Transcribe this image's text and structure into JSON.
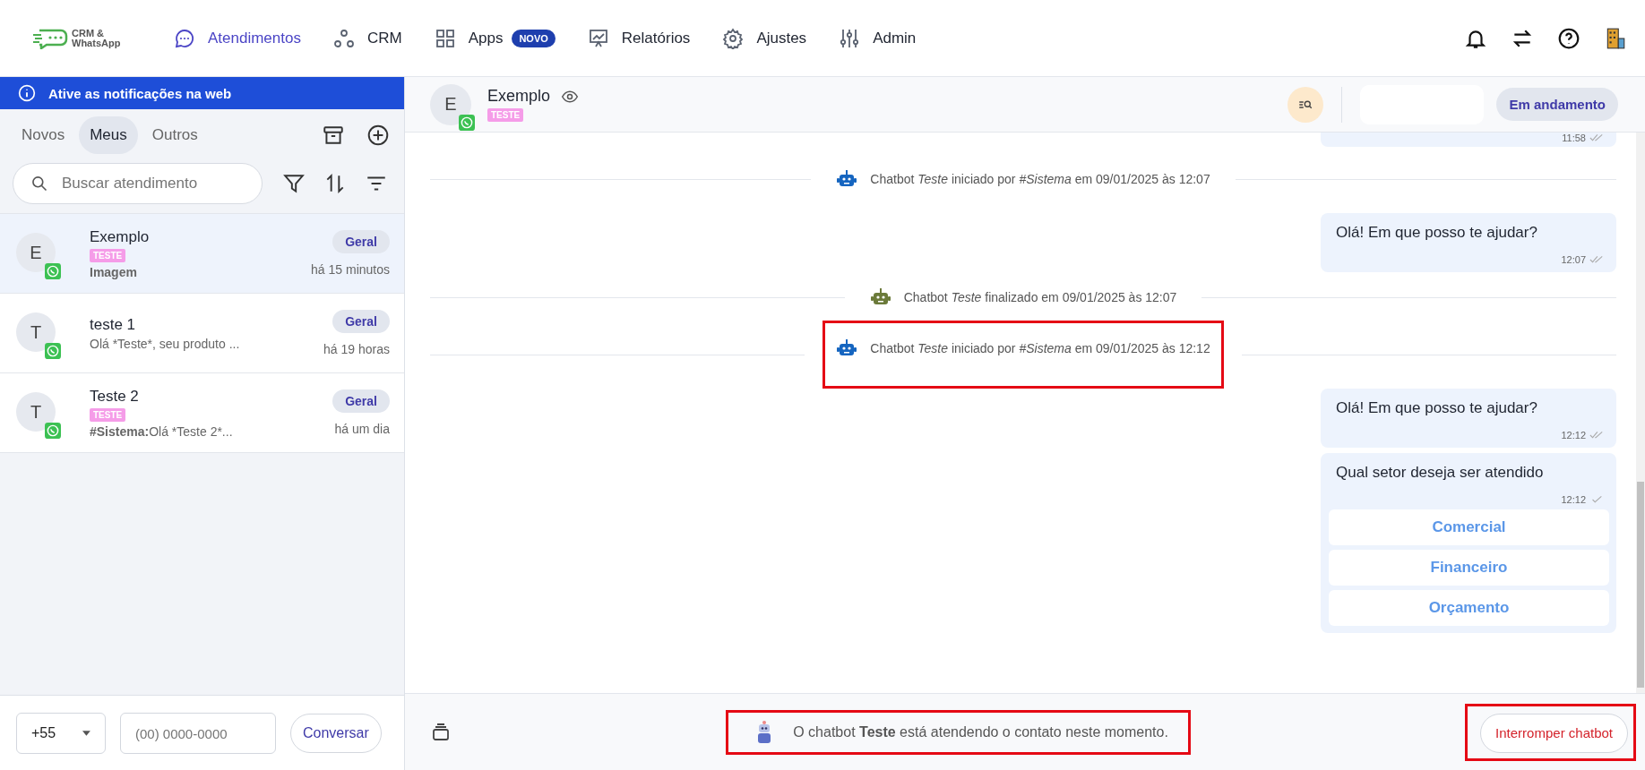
{
  "nav": {
    "logo": {
      "line_1": "CRM &",
      "line_2": "WhatsApp"
    },
    "items": [
      {
        "label": "Atendimentos",
        "selected": true
      },
      {
        "label": "CRM",
        "selected": false
      },
      {
        "label": "Apps",
        "badge": "NOVO",
        "selected": false
      },
      {
        "label": "Relatórios",
        "selected": false
      },
      {
        "label": "Ajustes",
        "selected": false
      },
      {
        "label": "Admin",
        "selected": false
      }
    ]
  },
  "notice": "Ative as notificações na web",
  "tabs": [
    {
      "label": "Novos",
      "selected": false
    },
    {
      "label": "Meus",
      "selected": true
    },
    {
      "label": "Outros",
      "selected": false
    }
  ],
  "search": {
    "placeholder": "Buscar atendimento"
  },
  "conversations": [
    {
      "initial": "E",
      "name": "Exemplo",
      "tag": "TESTE",
      "preview": "Imagem",
      "preview_bold": true,
      "queue": "Geral",
      "time": "há 15 minutos",
      "selected": true
    },
    {
      "initial": "T",
      "name": "teste 1",
      "preview": "Olá *Teste*, seu produto ...",
      "preview_bold": false,
      "queue": "Geral",
      "time": "há 19 horas",
      "selected": false
    },
    {
      "initial": "T",
      "name": "Teste 2",
      "tag": "TESTE",
      "preview_sender": "#Sistema:",
      "preview": "Olá *Teste 2*...",
      "preview_bold": false,
      "queue": "Geral",
      "time": "há um dia",
      "selected": false
    }
  ],
  "phone": {
    "country": "+55",
    "placeholder": "(00) 0000-0000",
    "button": "Conversar"
  },
  "chat": {
    "contact": {
      "initial": "E",
      "name": "Exemplo",
      "tag": "TESTE"
    },
    "status": "Em andamento",
    "messages": [
      {
        "kind": "partial",
        "time": "11:58",
        "read": true
      },
      {
        "kind": "event",
        "text": "Chatbot *Teste* iniciado por *#Sistema* em 09/01/2025 às 12:07",
        "color": "#1565c0",
        "highlighted": false
      },
      {
        "kind": "bubble",
        "text": "Olá! Em que posso te ajudar?",
        "time": "12:07",
        "read": true
      },
      {
        "kind": "event",
        "text": "Chatbot *Teste* finalizado em 09/01/2025 às 12:07",
        "color": "#6b7a3a",
        "highlighted": false
      },
      {
        "kind": "event",
        "text": "Chatbot *Teste* iniciado por *#Sistema* em 09/01/2025 às 12:12",
        "color": "#1565c0",
        "highlighted": true
      },
      {
        "kind": "bubble",
        "text": "Olá! Em que posso te ajudar?",
        "time": "12:12",
        "read": true
      },
      {
        "kind": "menu",
        "text": "Qual setor deseja ser atendido",
        "time": "12:12",
        "read": false,
        "options": [
          "Comercial",
          "Financeiro",
          "Orçamento"
        ]
      }
    ]
  },
  "footer": {
    "notice": "O chatbot **Teste** está atendendo o contato neste momento.",
    "notice_highlighted": true,
    "button": "Interromper chatbot",
    "button_highlighted": true
  }
}
